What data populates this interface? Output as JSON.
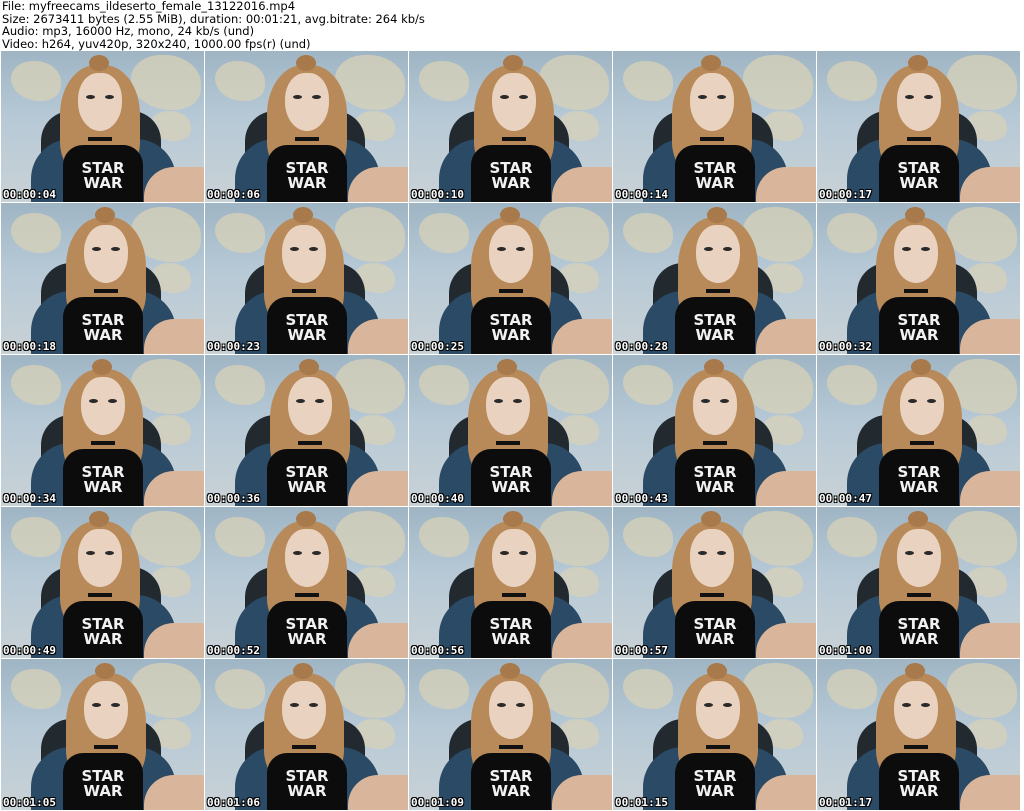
{
  "header": {
    "file": "File: myfreecams_ildeserto_female_13122016.mp4",
    "size": "Size: 2673411 bytes (2.55 MiB), duration: 00:01:21, avg.bitrate: 264 kb/s",
    "audio": "Audio: mp3, 16000 Hz, mono, 24 kb/s (und)",
    "video": "Video: h264, yuv420p, 320x240, 1000.00 fps(r) (und)"
  },
  "thumbnail_logo_text": [
    "STAR",
    "WAR"
  ],
  "timestamps": [
    "00:00:04",
    "00:00:06",
    "00:00:10",
    "00:00:14",
    "00:00:17",
    "00:00:18",
    "00:00:23",
    "00:00:25",
    "00:00:28",
    "00:00:32",
    "00:00:34",
    "00:00:36",
    "00:00:40",
    "00:00:43",
    "00:00:47",
    "00:00:49",
    "00:00:52",
    "00:00:56",
    "00:00:57",
    "00:01:00",
    "00:01:05",
    "00:01:06",
    "00:01:09",
    "00:01:15",
    "00:01:17"
  ]
}
